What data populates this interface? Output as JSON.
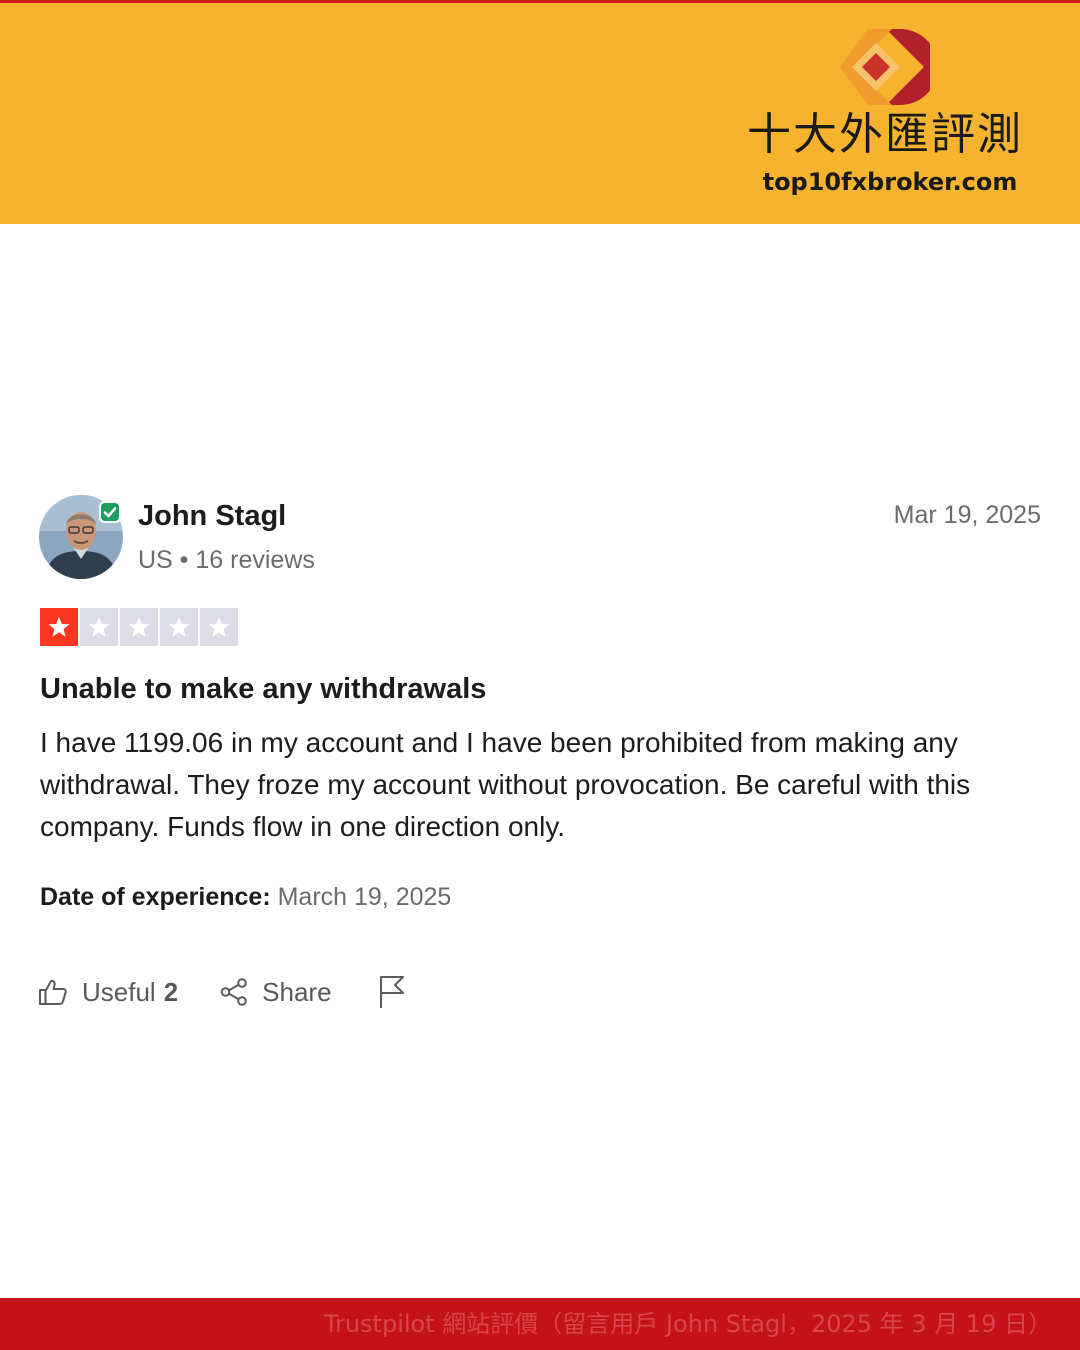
{
  "brand": {
    "name": "十大外匯評測",
    "url": "top10fxbroker.com",
    "logo_icon": "diamond-d-logo",
    "colors": {
      "header_bg": "#f5b32e",
      "logo_orange": "#f29b2f",
      "logo_red": "#b1202a"
    }
  },
  "review": {
    "reviewer": {
      "name": "John Stagl",
      "meta": "US • 16 reviews",
      "avatar_icon": "reviewer-avatar",
      "verified_icon": "verified-check-icon"
    },
    "date": "Mar 19, 2025",
    "rating": {
      "stars": 1,
      "max": 5,
      "filled_color": "#ff3722",
      "empty_color": "#dcdce6"
    },
    "title": "Unable to make any withdrawals",
    "body": "I have 1199.06 in my account and I have been prohibited from making any withdrawal. They froze my account without provocation. Be careful with this company. Funds flow in one direction only.",
    "experience": {
      "label": "Date of experience:",
      "value": "March 19, 2025"
    },
    "actions": {
      "useful_label": "Useful",
      "useful_count": "2",
      "share_label": "Share",
      "useful_icon": "thumbs-up-icon",
      "share_icon": "share-icon",
      "flag_icon": "flag-icon"
    }
  },
  "footer": {
    "caption": "Trustpilot 網站評價（留言用戶 John Stagl，2025 年 3 月 19 日）",
    "bg_color": "#c4121a"
  }
}
